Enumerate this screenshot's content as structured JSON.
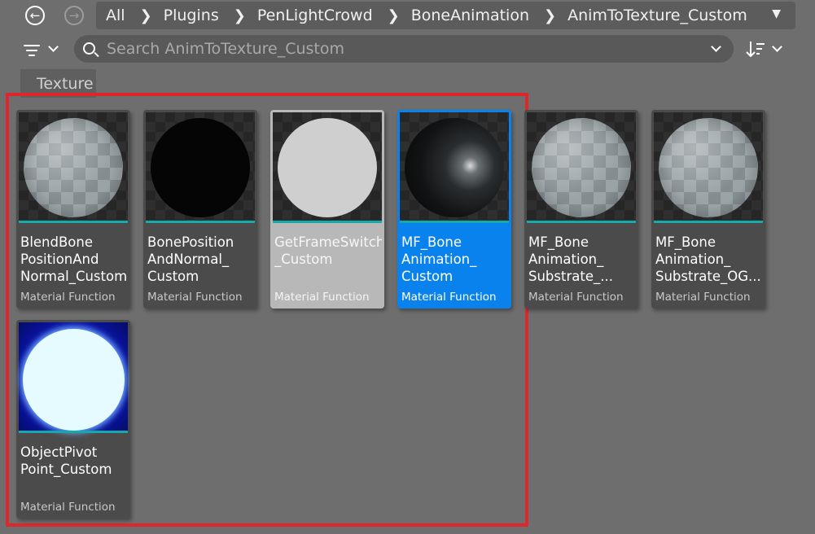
{
  "navigation": {
    "back_icon": "arrow-left-icon",
    "forward_icon": "arrow-right-icon",
    "breadcrumb": [
      "All",
      "Plugins",
      "PenLightCrowd",
      "BoneAnimation",
      "AnimToTexture_Custom"
    ],
    "separator_icon": "chevron-right-icon",
    "dropdown_icon": "chevron-down-icon"
  },
  "toolbar": {
    "filter_icon": "filter-icon",
    "search_placeholder": "Search AnimToTexture_Custom",
    "search_value": "",
    "sort_icon": "sort-icon"
  },
  "filters": {
    "active": [
      "Texture"
    ]
  },
  "colors": {
    "background": "#6e6e6e",
    "selected_tile": "#0a82ee",
    "hovered_tile": "#b8b8b8",
    "asset_type_bar": "#16a9a9",
    "highlight_box": "#e0262b"
  },
  "assets": [
    {
      "name": "BlendBone PositionAnd Normal_Custom",
      "type": "Material Function",
      "thumbnail": "checker-sphere",
      "state": "normal"
    },
    {
      "name": "BonePosition AndNormal_ Custom",
      "type": "Material Function",
      "thumbnail": "black-sphere",
      "state": "normal"
    },
    {
      "name": "GetFrameSwitch _Custom",
      "type": "Material Function",
      "thumbnail": "white-sphere",
      "state": "hovered"
    },
    {
      "name": "MF_Bone Animation_ Custom",
      "type": "Material Function",
      "thumbnail": "dark-glossy-sphere",
      "state": "selected"
    },
    {
      "name": "MF_Bone Animation_ Substrate_...",
      "type": "Material Function",
      "thumbnail": "checker-sphere",
      "state": "normal"
    },
    {
      "name": "MF_Bone Animation_ Substrate_OG...",
      "type": "Material Function",
      "thumbnail": "checker-sphere",
      "state": "normal"
    },
    {
      "name": "ObjectPivot Point_Custom",
      "type": "Material Function",
      "thumbnail": "glowing-white-sphere",
      "state": "normal"
    }
  ]
}
